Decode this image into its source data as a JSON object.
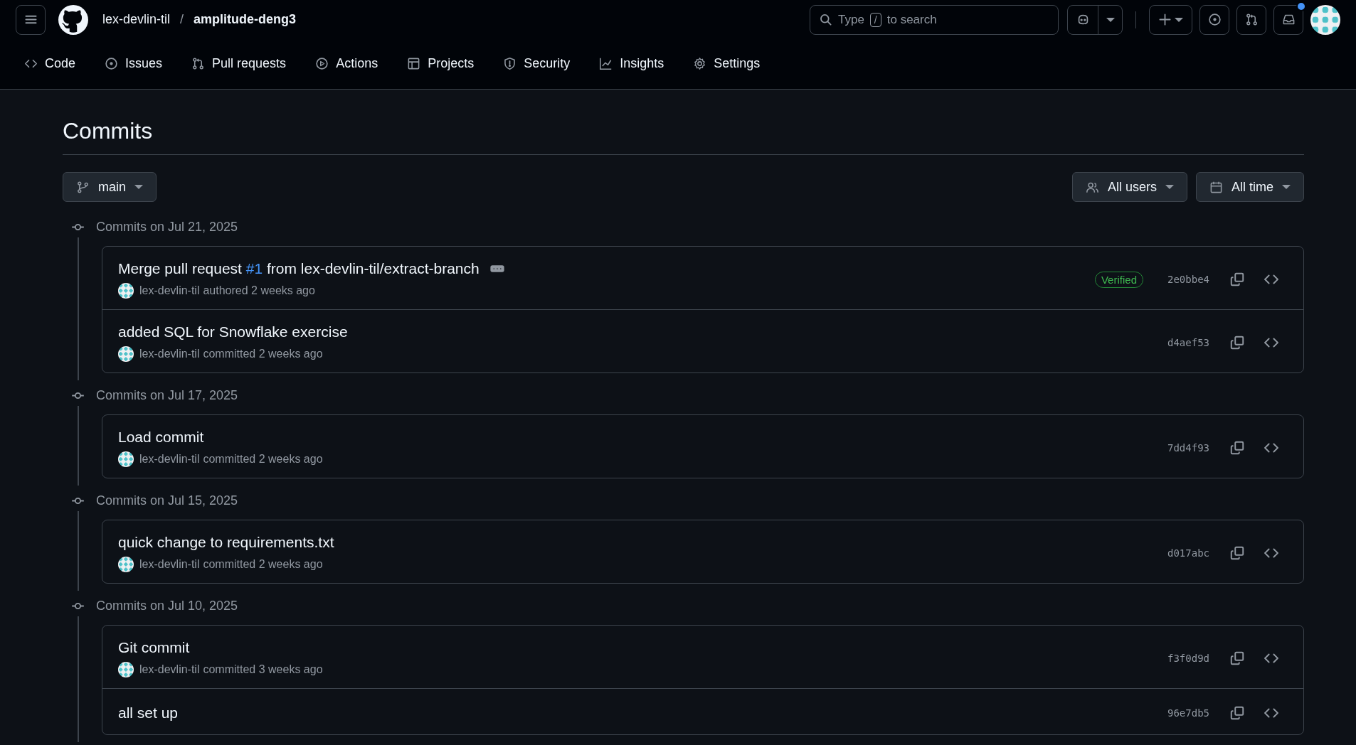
{
  "header": {
    "owner": "lex-devlin-til",
    "separator": "/",
    "repo": "amplitude-deng3",
    "search": {
      "before": "Type",
      "key": "/",
      "after": "to search"
    },
    "inbox_unread": true
  },
  "nav_tabs": [
    {
      "label": "Code",
      "selected": false
    },
    {
      "label": "Issues",
      "selected": false
    },
    {
      "label": "Pull requests",
      "selected": false
    },
    {
      "label": "Actions",
      "selected": false
    },
    {
      "label": "Projects",
      "selected": false
    },
    {
      "label": "Security",
      "selected": false
    },
    {
      "label": "Insights",
      "selected": false
    },
    {
      "label": "Settings",
      "selected": false
    }
  ],
  "page_title": "Commits",
  "filters": {
    "branch": "main",
    "users": "All users",
    "time": "All time"
  },
  "groups": [
    {
      "date_label": "Commits on Jul 21, 2025",
      "commits": [
        {
          "title": [
            {
              "kind": "text",
              "text": "Merge pull request "
            },
            {
              "kind": "link",
              "text": "#1"
            },
            {
              "kind": "text",
              "text": " from lex-devlin-til/extract-branch"
            }
          ],
          "expandable": true,
          "author": "lex-devlin-til",
          "action": "authored 2 weeks ago",
          "verified": true,
          "verified_label": "Verified",
          "hash": "2e0bbe4"
        },
        {
          "title": [
            {
              "kind": "text",
              "text": "added SQL for Snowflake exercise"
            }
          ],
          "expandable": false,
          "author": "lex-devlin-til",
          "action": "committed 2 weeks ago",
          "verified": false,
          "hash": "d4aef53"
        }
      ]
    },
    {
      "date_label": "Commits on Jul 17, 2025",
      "commits": [
        {
          "title": [
            {
              "kind": "text",
              "text": "Load commit"
            }
          ],
          "expandable": false,
          "author": "lex-devlin-til",
          "action": "committed 2 weeks ago",
          "verified": false,
          "hash": "7dd4f93"
        }
      ]
    },
    {
      "date_label": "Commits on Jul 15, 2025",
      "commits": [
        {
          "title": [
            {
              "kind": "text",
              "text": "quick change to requirements.txt"
            }
          ],
          "expandable": false,
          "author": "lex-devlin-til",
          "action": "committed 2 weeks ago",
          "verified": false,
          "hash": "d017abc"
        }
      ]
    },
    {
      "date_label": "Commits on Jul 10, 2025",
      "commits": [
        {
          "title": [
            {
              "kind": "text",
              "text": "Git commit"
            }
          ],
          "expandable": false,
          "author": "lex-devlin-til",
          "action": "committed 3 weeks ago",
          "verified": false,
          "hash": "f3f0d9d"
        },
        {
          "title": [
            {
              "kind": "text",
              "text": "all set up"
            }
          ],
          "expandable": false,
          "verified": false,
          "hash": "96e7db5"
        }
      ]
    }
  ]
}
